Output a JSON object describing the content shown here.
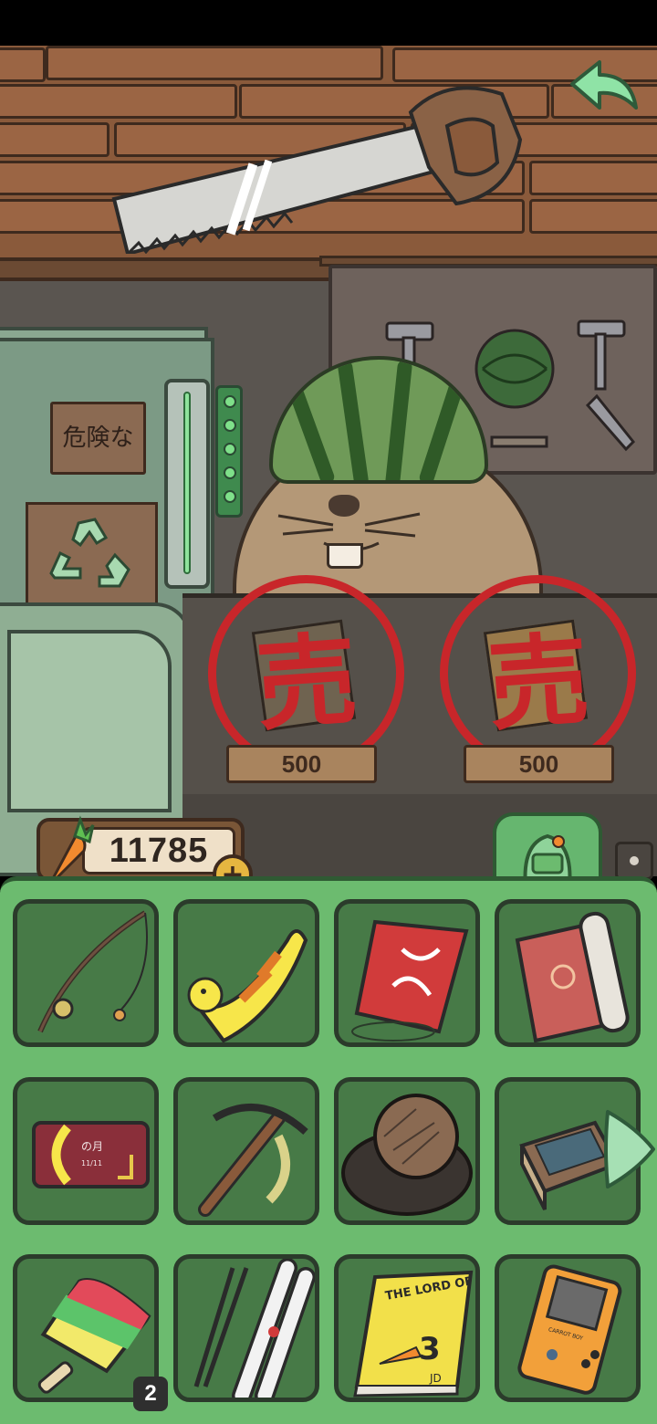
{
  "shop": {
    "sign_text": "危険な",
    "sold_glyph": "売",
    "items_for_sale": [
      {
        "price": "500",
        "status": "sold"
      },
      {
        "price": "500",
        "status": "sold"
      }
    ]
  },
  "currency": {
    "icon": "carrot-icon",
    "carrots": "11785",
    "add_icon": "plus-icon"
  },
  "navigation": {
    "back_icon": "back-arrow-icon",
    "tab_icon": "backpack-icon",
    "next_page_icon": "chevron-right-icon"
  },
  "inventory": {
    "slots": [
      {
        "icon": "fishing-rod-icon"
      },
      {
        "icon": "duck-float-icon"
      },
      {
        "icon": "kite-icon"
      },
      {
        "icon": "rolled-mat-icon"
      },
      {
        "icon": "calendar-card-icon",
        "card_text": "の月",
        "card_date": "11/11"
      },
      {
        "icon": "pickaxe-icon"
      },
      {
        "icon": "fur-hat-icon"
      },
      {
        "icon": "matchbox-icon"
      },
      {
        "icon": "popsicle-icon",
        "count": "2"
      },
      {
        "icon": "skis-icon"
      },
      {
        "icon": "book-icon",
        "book_title": "THE LORD OF THE CARROTS",
        "book_number": "3",
        "book_author": "JD"
      },
      {
        "icon": "handheld-game-icon",
        "console_label": "CARROT BOY"
      }
    ]
  },
  "colors": {
    "inventory_bg": "#6cbb6f",
    "slot_bg": "#477a47",
    "sold_red": "#c8262a",
    "wood": "#9b6544"
  }
}
